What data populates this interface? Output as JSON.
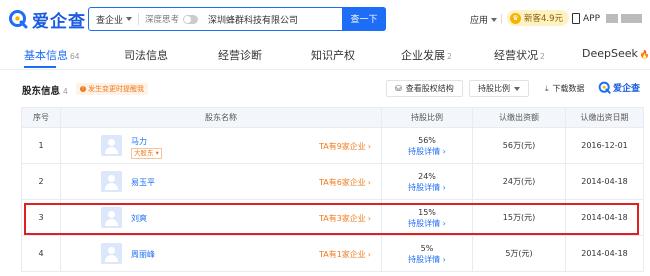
{
  "colors": {
    "brand": "#1e6df6",
    "accent": "#f07a1a",
    "highlight": "#e02020"
  },
  "header": {
    "logo_text": "爱企查",
    "search": {
      "type_label": "查企业",
      "deep_label": "深度思考",
      "query": "深圳蜂群科技有限公司",
      "button_label": "查一下",
      "clear_icon": "close-icon"
    },
    "apply_label": "应用",
    "vip_label": "新客4.9元",
    "app_label": "APP"
  },
  "tabs": [
    {
      "label": "基本信息",
      "count": "64"
    },
    {
      "label": "司法信息",
      "count": ""
    },
    {
      "label": "经营诊断",
      "count": ""
    },
    {
      "label": "知识产权",
      "count": ""
    },
    {
      "label": "企业发展",
      "count": "2"
    },
    {
      "label": "经营状况",
      "count": "2"
    },
    {
      "label": "DeepSeek",
      "count": ""
    }
  ],
  "section": {
    "title": "股东信息",
    "count": "4",
    "badge": "发生变更时提醒我",
    "equity_btn": "查看股权结构",
    "ratio_btn": "持股比例",
    "download_btn": "下载数据",
    "logo_text": "爱企查"
  },
  "table": {
    "headers": [
      "序号",
      "股东名称",
      "持股比例",
      "认缴出资额",
      "认缴出资日期"
    ],
    "rows": [
      {
        "no": "1",
        "name": "马力",
        "tag": "大股东",
        "ta": "TA有9家企业",
        "pct": "56%",
        "detail": "持股详情",
        "amount": "56万(元)",
        "date": "2016-12-01"
      },
      {
        "no": "2",
        "name": "易玉平",
        "tag": "",
        "ta": "TA有6家企业",
        "pct": "24%",
        "detail": "持股详情",
        "amount": "24万(元)",
        "date": "2014-04-18"
      },
      {
        "no": "3",
        "name": "刘爽",
        "tag": "",
        "ta": "TA有3家企业",
        "pct": "15%",
        "detail": "持股详情",
        "amount": "15万(元)",
        "date": "2014-04-18"
      },
      {
        "no": "4",
        "name": "周丽峰",
        "tag": "",
        "ta": "TA有1家企业",
        "pct": "5%",
        "detail": "持股详情",
        "amount": "5万(元)",
        "date": "2014-04-18"
      }
    ]
  }
}
